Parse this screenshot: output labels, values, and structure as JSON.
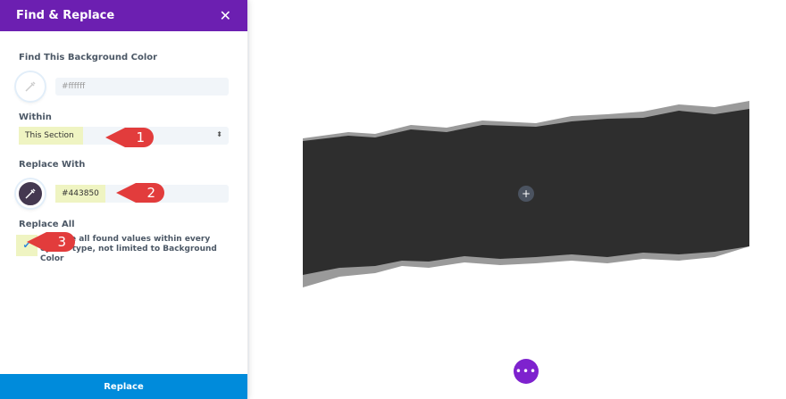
{
  "panel": {
    "title": "Find & Replace",
    "close": "✕",
    "find_label": "Find This Background Color",
    "find_value": "#ffffff",
    "within_label": "Within",
    "within_value": "This Section",
    "select_arrow": "⬍",
    "replace_label": "Replace With",
    "replace_value": "#443850",
    "replace_all_label": "Replace All",
    "replace_all_desc": "Replace all found values within every option type, not limited to Background Color",
    "check": "✔",
    "button": "Replace"
  },
  "callouts": [
    "1",
    "2",
    "3"
  ],
  "stage": {
    "plus": "+",
    "more": "•••"
  },
  "colors": {
    "accent": "#6c1fb1",
    "button": "#008bdb",
    "replace": "#443850"
  }
}
